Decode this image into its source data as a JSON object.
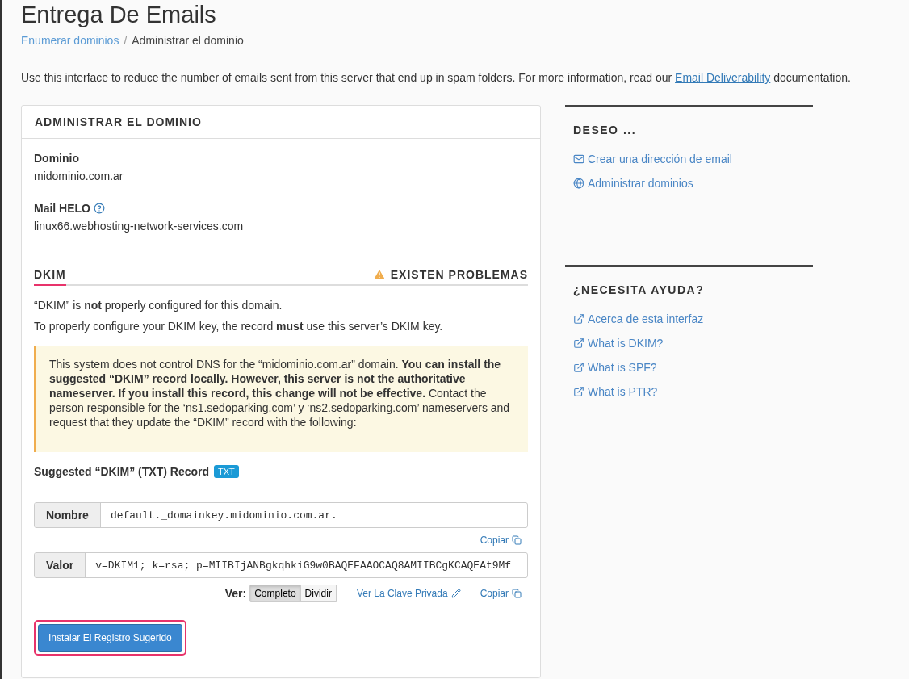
{
  "page": {
    "title": "Entrega De Emails"
  },
  "breadcrumb": [
    {
      "label": "Enumerar dominios",
      "link": true
    },
    {
      "separator": "/",
      "label": "Administrar el dominio",
      "link": false
    }
  ],
  "intro": {
    "before": "Use this interface to reduce the number of emails sent from this server that end up in spam folders. For more information, read our ",
    "link": "Email Deliverability",
    "after": " documentation."
  },
  "panel": {
    "title": "ADMINISTRAR EL DOMINIO",
    "fields": [
      {
        "label": "Dominio",
        "value": "midominio.com.ar",
        "help": false
      },
      {
        "label": "Mail HELO",
        "value": "linux66.webhosting-network-services.com",
        "help": true
      }
    ],
    "dkim": {
      "tab": "DKIM",
      "status": "EXISTEN PROBLEMAS",
      "messages": [
        "“DKIM” is **not** properly configured for this domain.",
        "To properly configure your DKIM key, the record **must** use this server’s DKIM key."
      ],
      "warning": "This system does not control DNS for the “midominio.com.ar” domain. **You can install the suggested “DKIM” record locally. However, this server is not the authoritative nameserver. If you install this record, this change will not be effective.** Contact the person responsible for the ‘ns1.sedoparking.com’ y ‘ns2.sedoparking.com’ nameservers and request that they update the “DKIM” record with the following:",
      "record_label": "Suggested “DKIM” (TXT) Record",
      "record_badge": "TXT",
      "name": {
        "label": "Nombre",
        "value": "default._domainkey.midominio.com.ar.",
        "copy": "Copiar"
      },
      "value": {
        "label": "Valor",
        "value": "v=DKIM1; k=rsa; p=MIIBIjANBgkqhkiG9w0BAQEFAAOCAQ8AMIIBCgKCAQEAt9Mf",
        "copy": "Copiar"
      },
      "view_label": "Ver:",
      "view_options": [
        {
          "label": "Completo",
          "selected": true
        },
        {
          "label": "Dividir",
          "selected": false
        }
      ],
      "private_key": "Ver La Clave Privada",
      "install": {
        "label": "Instalar El Registro Sugerido",
        "highlighted": true
      }
    }
  },
  "sidebar": [
    {
      "title": "DESEO ...",
      "links": [
        {
          "kind": "mail",
          "label": "Crear una dirección de email"
        },
        {
          "kind": "globe",
          "label": "Administrar dominios"
        }
      ]
    },
    {
      "title": "¿NECESITA AYUDA?",
      "links": [
        {
          "kind": "external",
          "label": "Acerca de esta interfaz"
        },
        {
          "kind": "external",
          "label": "What is DKIM?"
        },
        {
          "kind": "external",
          "label": "What is SPF?"
        },
        {
          "kind": "external",
          "label": "What is PTR?"
        }
      ]
    }
  ]
}
